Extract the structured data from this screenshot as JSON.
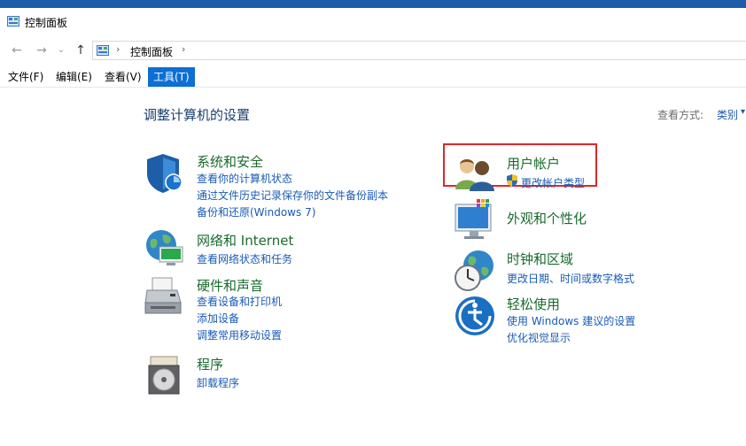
{
  "window": {
    "title": "控制面板"
  },
  "address": {
    "crumb": "控制面板"
  },
  "menu": [
    {
      "label": "文件(F)"
    },
    {
      "label": "编辑(E)"
    },
    {
      "label": "查看(V)"
    },
    {
      "label": "工具(T)"
    }
  ],
  "page": {
    "heading": "调整计算机的设置",
    "view_by_label": "查看方式:",
    "view_by_value": "类别"
  },
  "categories": {
    "system": {
      "title": "系统和安全",
      "links": [
        "查看你的计算机状态",
        "通过文件历史记录保存你的文件备份副本",
        "备份和还原(Windows 7)"
      ]
    },
    "network": {
      "title": "网络和 Internet",
      "links": [
        "查看网络状态和任务"
      ]
    },
    "hardware": {
      "title": "硬件和声音",
      "links": [
        "查看设备和打印机",
        "添加设备",
        "调整常用移动设置"
      ]
    },
    "programs": {
      "title": "程序",
      "links": [
        "卸载程序"
      ]
    },
    "users": {
      "title": "用户帐户",
      "links": [
        "更改帐户类型"
      ]
    },
    "appearance": {
      "title": "外观和个性化",
      "links": []
    },
    "clock": {
      "title": "时钟和区域",
      "links": [
        "更改日期、时间或数字格式"
      ]
    },
    "ease": {
      "title": "轻松使用",
      "links": [
        "使用 Windows 建议的设置",
        "优化视觉显示"
      ]
    }
  },
  "colors": {
    "title_green": "#196a2c",
    "link_blue": "#1a5bb5",
    "highlight_red": "#e0252b",
    "menu_active": "#0c6fd4"
  }
}
